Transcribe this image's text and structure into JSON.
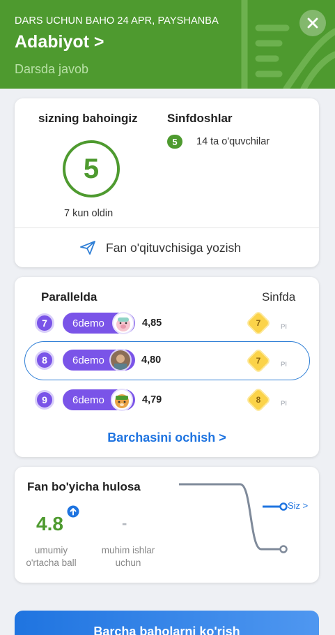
{
  "header": {
    "lesson_info": "DARS UCHUN BAHO 24 APR, PAYSHANBA",
    "subject": "Adabiyot >",
    "grade_type": "Darsda javob",
    "color": "#4e9a2f"
  },
  "grade_card": {
    "your_grade_label": "sizning bahoingiz",
    "grade": "5",
    "time_ago": "7 kun oldin",
    "classmates_label": "Sinfdoshlar",
    "classmates_grade": "5",
    "classmates_count": "14 ta o'quvchilar",
    "message_teacher": "Fan o'qituvchisiga yozish"
  },
  "ranking": {
    "parallel_label": "Parallelda",
    "class_label": "Sinfda",
    "rows": [
      {
        "rank": "7",
        "name": "6demo",
        "score": "4,85",
        "class_rank": "7",
        "suffix": "PI",
        "avatar": "pig-avatar-icon"
      },
      {
        "rank": "8",
        "name": "6demo",
        "score": "4,80",
        "class_rank": "7",
        "suffix": "PI",
        "avatar": "photo-avatar"
      },
      {
        "rank": "9",
        "name": "6demo",
        "score": "4,79",
        "class_rank": "8",
        "suffix": "PI",
        "avatar": "deer-avatar-icon"
      }
    ],
    "open_all": "Barchasini ochish >",
    "accent": "#7a54e8",
    "link_color": "#1f74e0"
  },
  "summary": {
    "title": "Fan bo'yicha hulosa",
    "average": "4.8",
    "average_label_line1": "umumiy",
    "average_label_line2": "o'rtacha ball",
    "important": "-",
    "important_label_line1": "muhim ishlar",
    "important_label_line2": "uchun",
    "you_label": "Siz >"
  },
  "footer": {
    "all_grades": "Barcha baholarni ko'rish"
  }
}
